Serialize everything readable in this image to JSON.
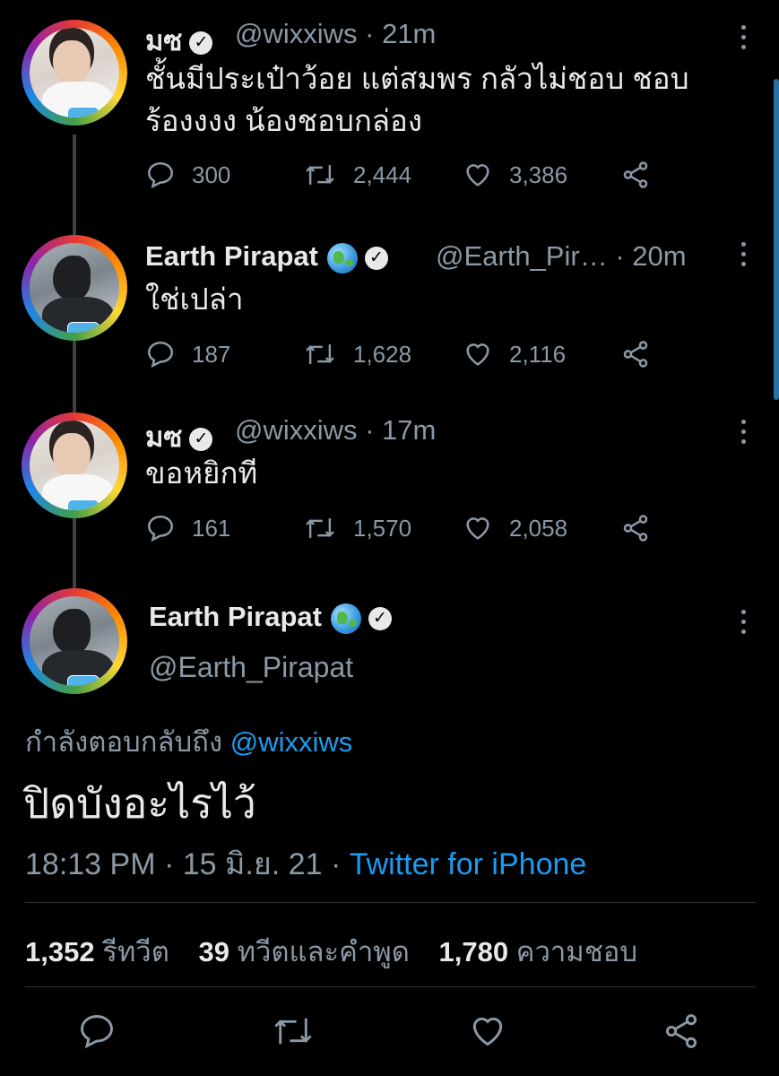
{
  "thread": [
    {
      "display_name": "มซ",
      "handle_time": "@wixxiws · 21m",
      "text_lines": [
        "ชั้นมีประเป๋าว้อย แต่สมพร กลัวไม่ชอบ ชอบ",
        "ร้องงงง น้องชอบกล่อง"
      ],
      "replies": "300",
      "retweets": "2,444",
      "likes": "3,386",
      "avatar_variant": "light"
    },
    {
      "display_name": "Earth Pirapat",
      "handle_time": "@Earth_Pir… · 20m",
      "text_lines": [
        "ใช่เปล่า"
      ],
      "replies": "187",
      "retweets": "1,628",
      "likes": "2,116",
      "avatar_variant": "dark"
    },
    {
      "display_name": "มซ",
      "handle_time": "@wixxiws · 17m",
      "text_lines": [
        "ขอหยิกที"
      ],
      "replies": "161",
      "retweets": "1,570",
      "likes": "2,058",
      "avatar_variant": "light"
    }
  ],
  "main_tweet": {
    "display_name": "Earth Pirapat",
    "handle": "@Earth_Pirapat",
    "reply_prefix": "กำลังตอบกลับถึง",
    "reply_mention": "@wixxiws",
    "text": "ปิดบังอะไรไว้",
    "timestamp": "18:13 PM · 15 มิ.ย. 21 ·",
    "client": "Twitter for iPhone",
    "retweet_count": "1,352",
    "retweet_label": "รีทวีต",
    "quote_count": "39",
    "quote_label": "ทวีตและคำพูด",
    "like_count": "1,780",
    "like_label": "ความชอบ"
  },
  "icons": {
    "reply": "reply-icon",
    "retweet": "retweet-icon",
    "like": "heart-icon",
    "share": "share-icon",
    "verified": "verified-badge-icon",
    "globe": "earth-globe-icon",
    "more": "more-options-icon"
  },
  "colors": {
    "background": "#000000",
    "link": "#1d9bf0",
    "secondary_text": "#8b98a5",
    "primary_text": "#e7e9ea"
  }
}
